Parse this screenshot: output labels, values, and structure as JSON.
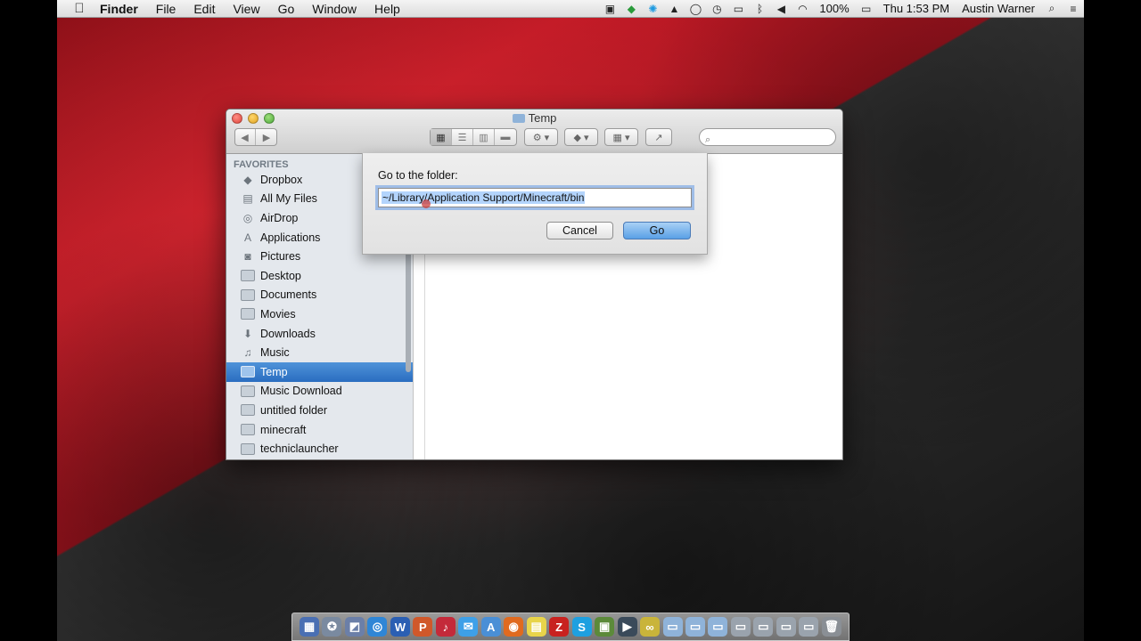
{
  "menubar": {
    "app_name": "Finder",
    "menus": [
      "File",
      "Edit",
      "View",
      "Go",
      "Window",
      "Help"
    ],
    "battery": "100%",
    "clock": "Thu 1:53 PM",
    "user": "Austin Warner",
    "tray_icons": [
      "camera-icon",
      "evernote-icon",
      "skype-icon",
      "bell-icon",
      "chat-bubble-icon",
      "time-machine-icon",
      "display-icon",
      "bluetooth-icon",
      "volume-icon",
      "wifi-icon",
      "battery-icon"
    ]
  },
  "window": {
    "title": "Temp",
    "search_placeholder": ""
  },
  "sidebar": {
    "heading": "FAVORITES",
    "items": [
      {
        "label": "Dropbox",
        "icon": "dropbox-icon"
      },
      {
        "label": "All My Files",
        "icon": "all-files-icon"
      },
      {
        "label": "AirDrop",
        "icon": "airdrop-icon"
      },
      {
        "label": "Applications",
        "icon": "applications-icon"
      },
      {
        "label": "Pictures",
        "icon": "camera-icon"
      },
      {
        "label": "Desktop",
        "icon": "desktop-icon"
      },
      {
        "label": "Documents",
        "icon": "document-icon"
      },
      {
        "label": "Movies",
        "icon": "film-icon"
      },
      {
        "label": "Downloads",
        "icon": "download-icon"
      },
      {
        "label": "Music",
        "icon": "music-note-icon"
      },
      {
        "label": "Temp",
        "icon": "folder-icon",
        "selected": true
      },
      {
        "label": "Music Download",
        "icon": "folder-icon"
      },
      {
        "label": "untitled folder",
        "icon": "folder-icon"
      },
      {
        "label": "minecraft",
        "icon": "folder-icon"
      },
      {
        "label": "techniclauncher",
        "icon": "folder-icon"
      }
    ]
  },
  "sheet": {
    "label": "Go to the folder:",
    "path_value": "~/Library/Application Support/Minecraft/bin",
    "cancel_label": "Cancel",
    "go_label": "Go"
  },
  "dock": {
    "apps": [
      {
        "name": "launchpad-icon",
        "color": "#4a6fb3",
        "glyph": "▦"
      },
      {
        "name": "safari-compass-icon",
        "color": "#7a8aa0",
        "glyph": "✪"
      },
      {
        "name": "preview-icon",
        "color": "#6b7fa8",
        "glyph": "◩"
      },
      {
        "name": "safari-icon",
        "color": "#2f86d6",
        "glyph": "◎"
      },
      {
        "name": "word-icon",
        "color": "#2b5fb3",
        "glyph": "W"
      },
      {
        "name": "powerpoint-icon",
        "color": "#d0582a",
        "glyph": "P"
      },
      {
        "name": "itunes-icon",
        "color": "#c42a3a",
        "glyph": "♪"
      },
      {
        "name": "messages-icon",
        "color": "#3ea0e8",
        "glyph": "✉"
      },
      {
        "name": "app-store-icon",
        "color": "#4a8fd6",
        "glyph": "A"
      },
      {
        "name": "firefox-icon",
        "color": "#e06a1f",
        "glyph": "◉"
      },
      {
        "name": "stickies-icon",
        "color": "#e8d44a",
        "glyph": "▤"
      },
      {
        "name": "filezilla-icon",
        "color": "#c8221f",
        "glyph": "Z"
      },
      {
        "name": "skype-icon",
        "color": "#1ea0e0",
        "glyph": "S"
      },
      {
        "name": "minecraft-icon",
        "color": "#5c8a3a",
        "glyph": "▣"
      },
      {
        "name": "video-editor-icon",
        "color": "#3a4a5a",
        "glyph": "▶"
      },
      {
        "name": "webex-icon",
        "color": "#c9b43a",
        "glyph": "∞"
      },
      {
        "name": "applications-folder-icon",
        "color": "#8fb3d9",
        "glyph": "▭"
      },
      {
        "name": "documents-folder-icon",
        "color": "#8fb3d9",
        "glyph": "▭"
      },
      {
        "name": "downloads-folder-icon",
        "color": "#8fb3d9",
        "glyph": "▭"
      },
      {
        "name": "stack-icon",
        "color": "#9aa3ad",
        "glyph": "▭"
      },
      {
        "name": "stack-icon",
        "color": "#9aa3ad",
        "glyph": "▭"
      },
      {
        "name": "stack-icon",
        "color": "#9aa3ad",
        "glyph": "▭"
      },
      {
        "name": "stack-icon",
        "color": "#9aa3ad",
        "glyph": "▭"
      },
      {
        "name": "trash-icon",
        "color": "#8a8f95",
        "glyph": "🗑"
      }
    ]
  },
  "colors": {
    "selection": "#3a7fcf",
    "wallpaper_red": "#b0141e",
    "wallpaper_dark": "#2a2a2a"
  }
}
